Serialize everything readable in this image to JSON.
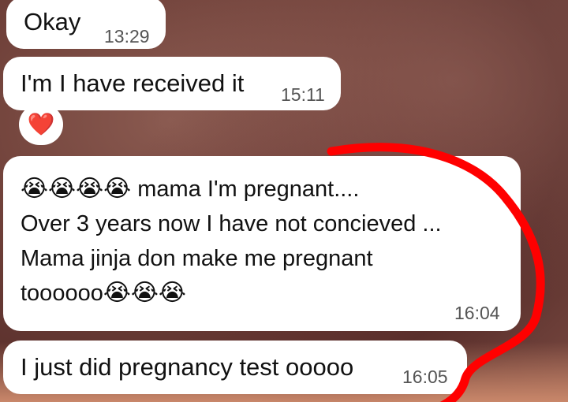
{
  "messages": [
    {
      "text": "Okay",
      "time": "13:29"
    },
    {
      "text": "I'm I have received it",
      "time": "15:11",
      "reaction": "❤️"
    },
    {
      "line1_emoji": "😭😭😭😭",
      "line1": " mama I'm pregnant....",
      "line2": "Over 3 years now I have not concieved ...",
      "line3": "Mama jinja don make me pregnant",
      "line4": "toooooo",
      "line4_emoji": "😭😭😭",
      "time": "16:04"
    },
    {
      "text": "I just did pregnancy test ooooo",
      "time": "16:05"
    }
  ],
  "colors": {
    "bubble": "#ffffff",
    "annotation": "#ff0000"
  }
}
